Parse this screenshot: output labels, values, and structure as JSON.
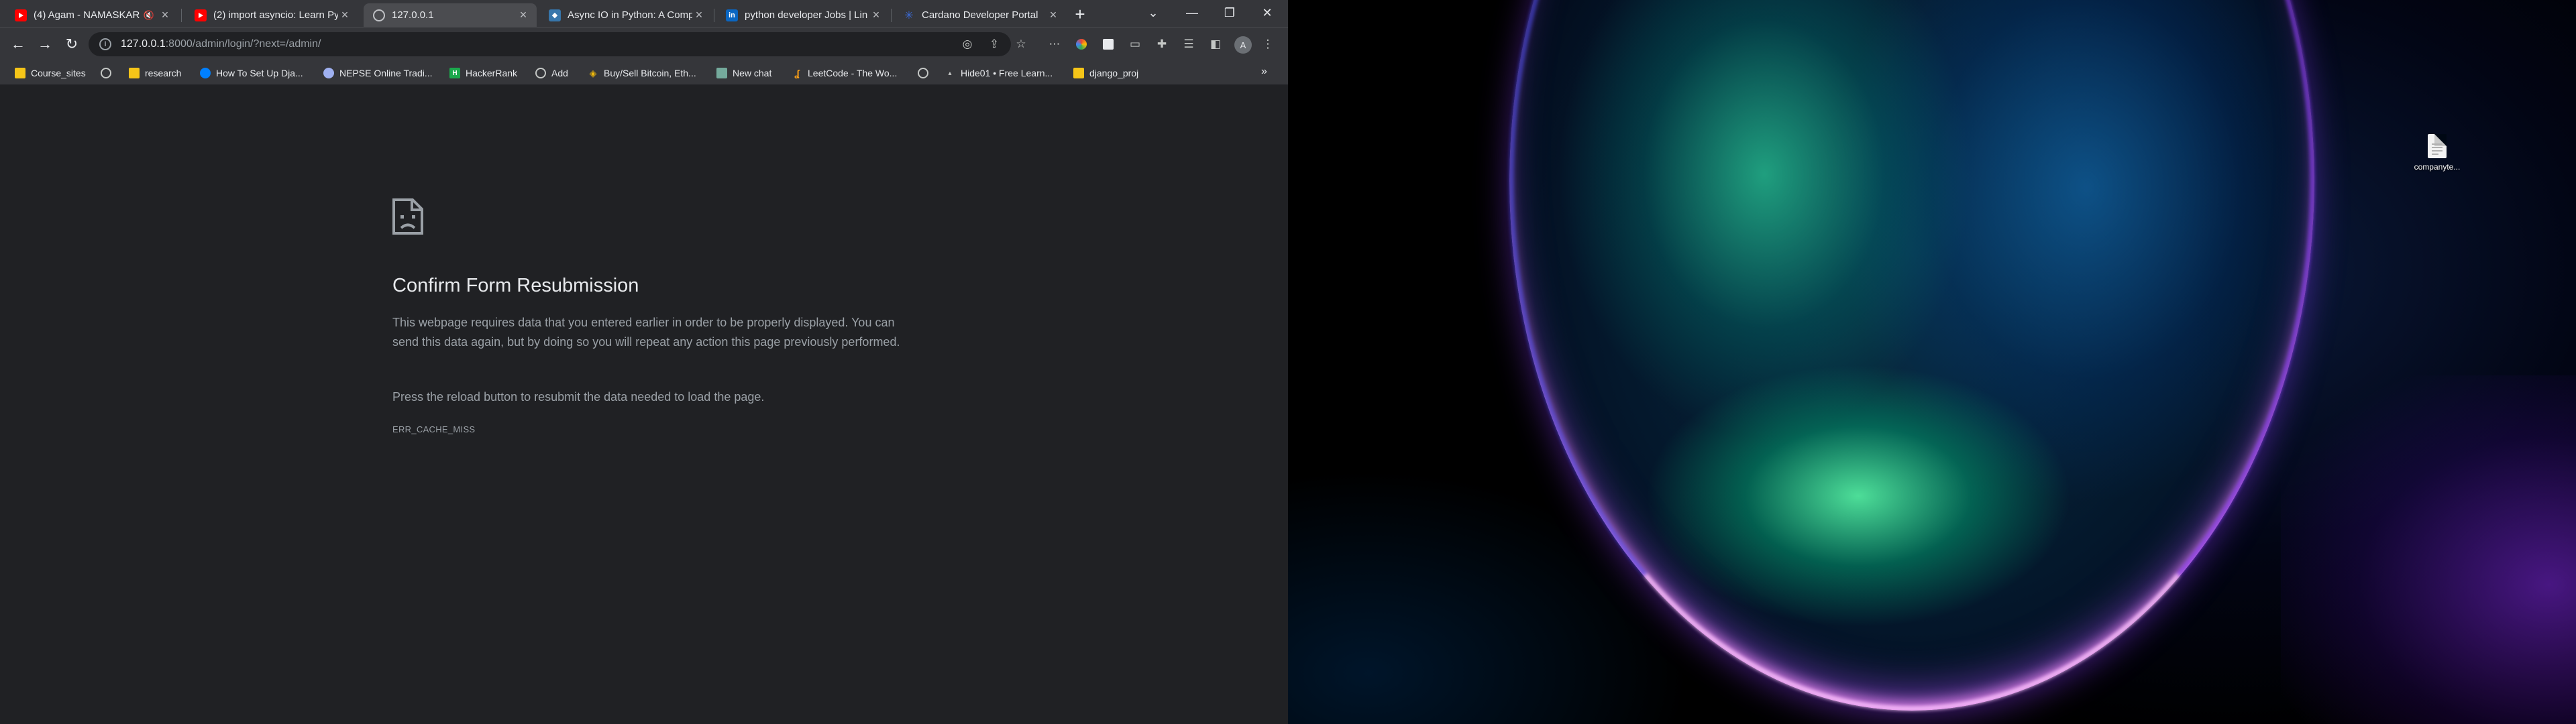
{
  "browser": {
    "tabs": [
      {
        "title": "(4) Agam - NAMASKAR",
        "favicon": "youtube-icon",
        "audio": "speaker-muted-icon"
      },
      {
        "title": "(2) import asyncio: Learn Py",
        "favicon": "youtube-icon"
      },
      {
        "title": "127.0.0.1",
        "favicon": "globe-icon",
        "active": true
      },
      {
        "title": "Async IO in Python: A Comp",
        "favicon": "python-icon"
      },
      {
        "title": "python developer Jobs | Lin",
        "favicon": "linkedin-icon"
      },
      {
        "title": "Cardano Developer Portal",
        "favicon": "cardano-icon"
      }
    ],
    "new_tab_label": "+",
    "window_controls": {
      "tab_search": "⌄",
      "minimize": "—",
      "restore": "❐",
      "close": "✕"
    },
    "address": {
      "host": "127.0.0.1",
      "path": ":8000/admin/login/?next=/admin/"
    },
    "profile_initial": "A",
    "bookmarks": [
      {
        "label": "Course_sites",
        "icon": "folder-icon"
      },
      {
        "label": "",
        "icon": "globe-icon"
      },
      {
        "label": "research",
        "icon": "folder-icon"
      },
      {
        "label": "How To Set Up Dja...",
        "icon": "globe-icon"
      },
      {
        "label": "NEPSE Online Tradi...",
        "icon": "nepse-icon"
      },
      {
        "label": "HackerRank",
        "icon": "hackerrank-icon"
      },
      {
        "label": "Add",
        "icon": "globe-icon"
      },
      {
        "label": "Buy/Sell Bitcoin, Eth...",
        "icon": "binance-icon"
      },
      {
        "label": "New chat",
        "icon": "chatgpt-icon"
      },
      {
        "label": "LeetCode - The Wo...",
        "icon": "leetcode-icon"
      },
      {
        "label": "",
        "icon": "globe-icon"
      },
      {
        "label": "Hide01 • Free Learn...",
        "icon": "lock-icon"
      },
      {
        "label": "django_proj",
        "icon": "folder-icon"
      }
    ],
    "bookmarks_overflow": "»"
  },
  "error_page": {
    "title": "Confirm Form Resubmission",
    "description": "This webpage requires data that you entered earlier in order to be properly displayed. You can send this data again, but by doing so you will repeat any action this page previously performed.",
    "hint": "Press the reload button to resubmit the data needed to load the page.",
    "code": "ERR_CACHE_MISS"
  },
  "desktop": {
    "icons": [
      {
        "label": "companyte...",
        "icon": "text-file-icon"
      }
    ]
  },
  "colors": {
    "page_bg": "#202124",
    "chrome_bg": "#35363a",
    "text_primary": "#e8eaed",
    "text_secondary": "#9aa0a6"
  }
}
